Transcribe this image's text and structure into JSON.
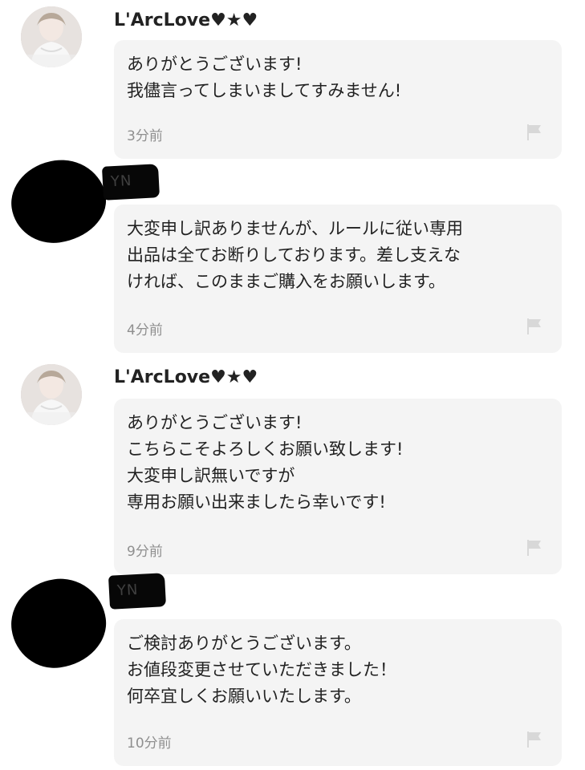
{
  "icons": {
    "heart": "heart-icon",
    "star": "star-icon",
    "flag": "flag-icon",
    "avatar": "profile-photo"
  },
  "colors": {
    "bubble": "#f4f4f4",
    "text": "#222222",
    "time": "#8f8f8f",
    "flag": "#d9d9d9"
  },
  "comments": [
    {
      "author": "L'ArcLove♥★♥",
      "text": "ありがとうございます!\n我儘言ってしまいましてすみません!",
      "time": "3分前"
    },
    {
      "author_tag": "YN",
      "text": "大変申し訳ありませんが、ルールに従い専用\n出品は全てお断りしております。差し支えな\nければ、このままご購入をお願いします。",
      "time": "4分前"
    },
    {
      "author": "L'ArcLove♥★♥",
      "text": "ありがとうございます!\nこちらこそよろしくお願い致します!\n大変申し訳無いですが\n専用お願い出来ましたら幸いです!",
      "time": "9分前"
    },
    {
      "author_tag": "YN",
      "text": "ご検討ありがとうございます。\nお値段変更させていただきました！\n何卒宜しくお願いいたします。",
      "time": "10分前"
    }
  ]
}
